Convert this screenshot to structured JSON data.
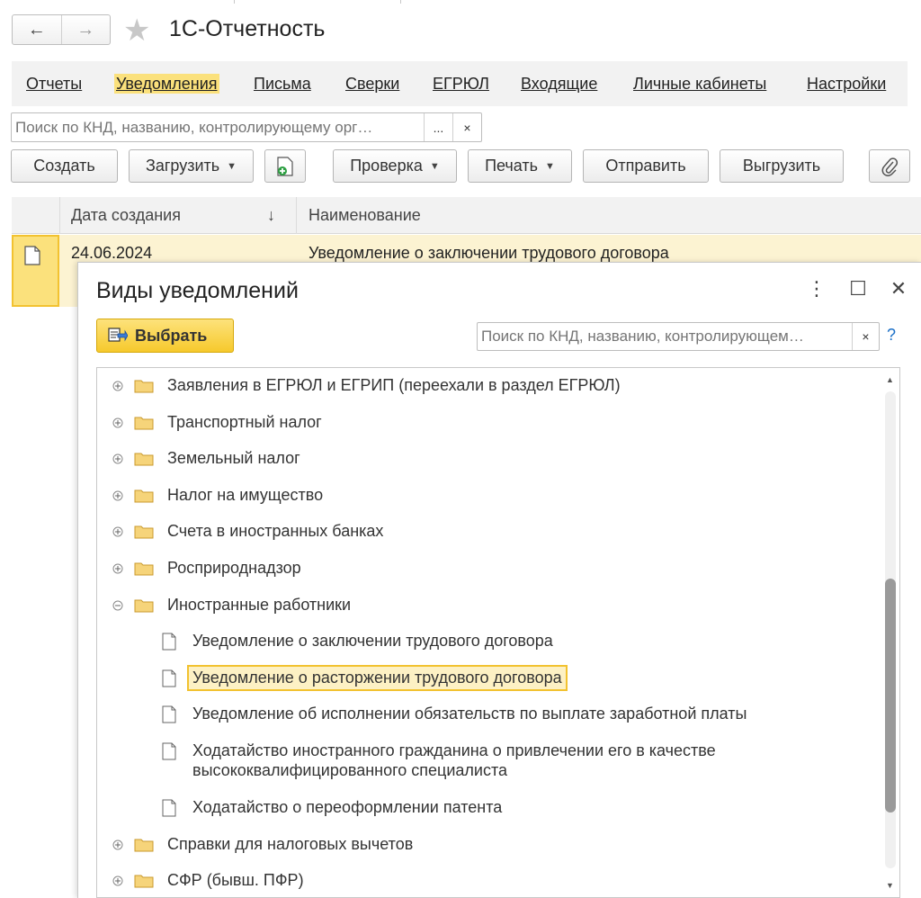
{
  "app": {
    "title": "1С-Отчетность"
  },
  "nav": {
    "back": "←",
    "forward": "→"
  },
  "tabs": [
    {
      "label": "Отчеты",
      "active": false
    },
    {
      "label": "Уведомления",
      "active": true
    },
    {
      "label": "Письма",
      "active": false
    },
    {
      "label": "Сверки",
      "active": false
    },
    {
      "label": "ЕГРЮЛ",
      "active": false
    },
    {
      "label": "Входящие",
      "active": false
    },
    {
      "label": "Личные кабинеты",
      "active": false
    },
    {
      "label": "Настройки",
      "active": false
    }
  ],
  "search": {
    "placeholder": "Поиск по КНД, названию, контролирующему орг…",
    "more": "...",
    "clear": "×"
  },
  "toolbar": {
    "create": "Создать",
    "load": "Загрузить",
    "check": "Проверка",
    "print": "Печать",
    "send": "Отправить",
    "export": "Выгрузить"
  },
  "grid": {
    "columns": {
      "date": "Дата создания",
      "sort_arrow": "↓",
      "name": "Наименование"
    },
    "rows": [
      {
        "date": "24.06.2024",
        "name": "Уведомление о заключении трудового договора"
      }
    ]
  },
  "modal": {
    "title": "Виды уведомлений",
    "more": "⋮",
    "maximize": "☐",
    "close": "✕",
    "select_label": "Выбрать",
    "search_placeholder": "Поиск по КНД, названию, контролирующем…",
    "search_clear": "×",
    "help": "?",
    "tree": {
      "groups_before": [
        "Заявления в ЕГРЮЛ и ЕГРИП (переехали в раздел ЕГРЮЛ)",
        "Транспортный налог",
        "Земельный налог",
        "Налог на имущество",
        "Счета в иностранных банках",
        "Росприроднадзор"
      ],
      "expanded_group": "Иностранные работники",
      "children": [
        "Уведомление о заключении трудового договора",
        "Уведомление о расторжении трудового договора",
        "Уведомление об исполнении обязательств по выплате заработной платы",
        "Ходатайство иностранного гражданина о привлечении его в качестве",
        "высококвалифицированного специалиста",
        "Ходатайство о переоформлении патента"
      ],
      "selected_child": "Уведомление о расторжении трудового договора",
      "groups_after": [
        "Справки для налоговых вычетов",
        "СФР (бывш. ПФР)"
      ]
    }
  },
  "colors": {
    "accent": "#fbe17c",
    "selection_border": "#f2c230",
    "row_highlight": "#fcf3d2"
  }
}
